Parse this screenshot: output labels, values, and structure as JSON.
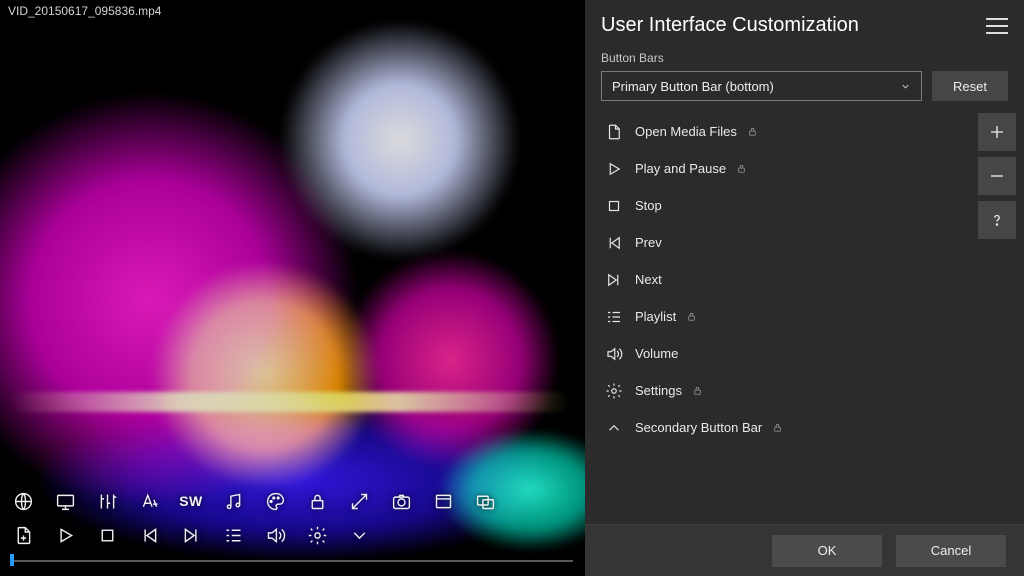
{
  "video": {
    "filename": "VID_20150617_095836.mp4"
  },
  "toolbar_row1_sw": "SW",
  "panel": {
    "title": "User Interface Customization",
    "section_label": "Button Bars",
    "dropdown_value": "Primary Button Bar (bottom)",
    "reset_label": "Reset",
    "ok_label": "OK",
    "cancel_label": "Cancel"
  },
  "items": [
    {
      "label": "Open Media Files",
      "locked": true,
      "icon": "file"
    },
    {
      "label": "Play and Pause",
      "locked": true,
      "icon": "play"
    },
    {
      "label": "Stop",
      "locked": false,
      "icon": "stop"
    },
    {
      "label": "Prev",
      "locked": false,
      "icon": "prev"
    },
    {
      "label": "Next",
      "locked": false,
      "icon": "next"
    },
    {
      "label": "Playlist",
      "locked": true,
      "icon": "playlist"
    },
    {
      "label": "Volume",
      "locked": false,
      "icon": "volume"
    },
    {
      "label": "Settings",
      "locked": true,
      "icon": "gear"
    },
    {
      "label": "Secondary Button Bar",
      "locked": true,
      "icon": "collapse"
    }
  ]
}
